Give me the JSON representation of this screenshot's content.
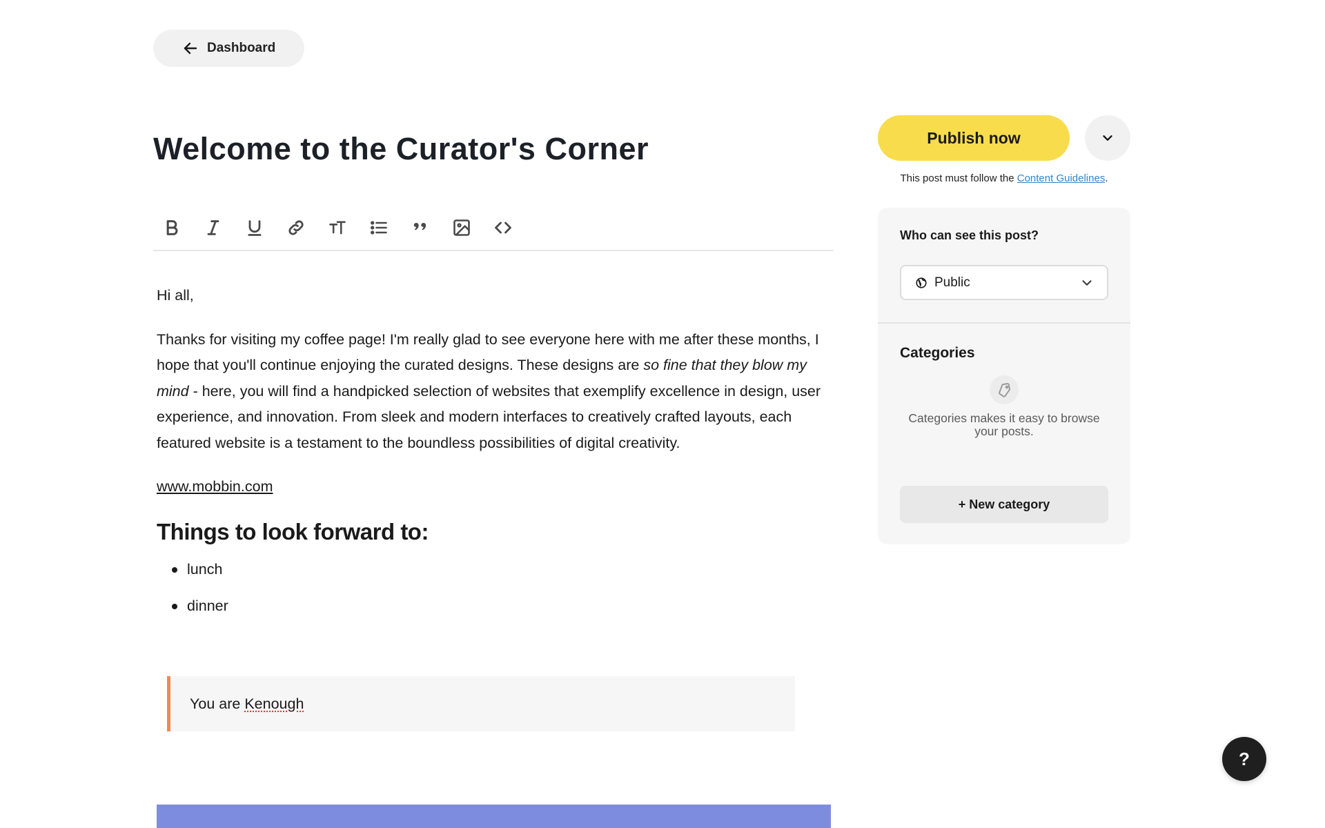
{
  "nav": {
    "back_label": "Dashboard"
  },
  "post": {
    "title": "Welcome to the Curator's Corner"
  },
  "toolbar": {
    "tools": [
      "bold-icon",
      "italic-icon",
      "underline-icon",
      "link-icon",
      "text-size-icon",
      "list-icon",
      "quote-icon",
      "image-icon",
      "code-icon"
    ]
  },
  "content": {
    "greeting": "Hi all,",
    "para_part1": "Thanks for visiting my coffee page! I'm really glad to see everyone here with me after these months, I hope that you'll continue enjoying the curated designs. These designs are ",
    "para_italic": "so fine that they blow my mind",
    "para_part2": " - here, you will find a handpicked selection of websites that exemplify excellence in design, user experience, and innovation. From sleek and modern interfaces to creatively crafted layouts, each featured website is a testament to the boundless possibilities of digital creativity.",
    "link_text": "www.mobbin.com",
    "heading": "Things to look forward to:",
    "list_items": [
      "lunch",
      "dinner"
    ],
    "quote_prefix": "You are ",
    "quote_word": "Kenough"
  },
  "sidebar": {
    "publish_label": "Publish now",
    "guidelines_prefix": "This post must follow the ",
    "guidelines_link": "Content Guidelines",
    "guidelines_suffix": ".",
    "visibility_label": "Who can see this post?",
    "visibility_value": "Public",
    "categories_label": "Categories",
    "categories_desc": "Categories makes it easy to browse your posts.",
    "new_category_label": "+ New category"
  },
  "help": {
    "label": "?"
  },
  "colors": {
    "publish": "#f8dc4b",
    "quote_border": "#ee8a55",
    "link": "#2f86c9",
    "embed_block": "#7e8ce0"
  }
}
